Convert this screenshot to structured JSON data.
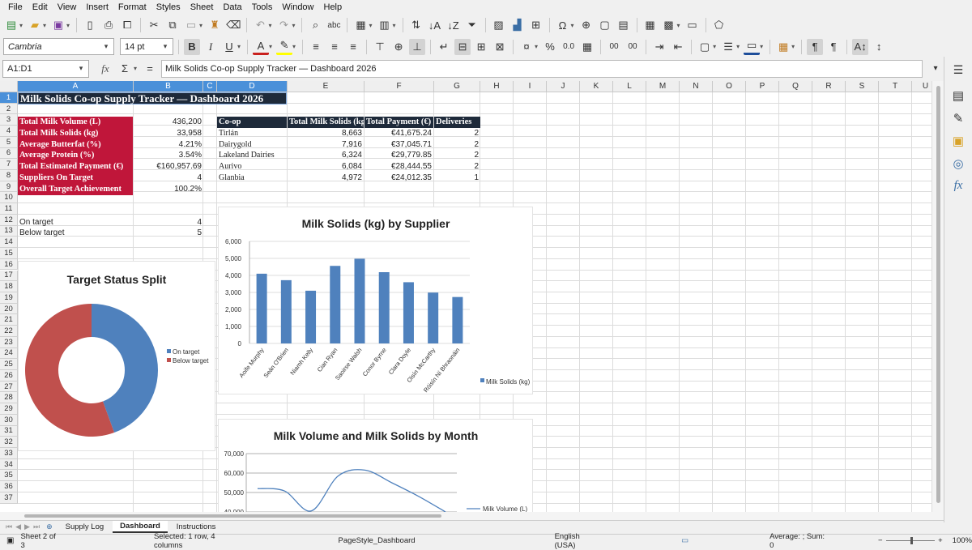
{
  "menu": [
    "File",
    "Edit",
    "View",
    "Insert",
    "Format",
    "Styles",
    "Sheet",
    "Data",
    "Tools",
    "Window",
    "Help"
  ],
  "toolbar": {
    "font_name": "Cambria",
    "font_size": "14 pt",
    "bold": "B",
    "italic": "I",
    "underline": "U",
    "percent": "%",
    "decimal": "0.0",
    "decimal_places": "00",
    "omega": "Ω"
  },
  "formula": {
    "cell_ref": "A1:D1",
    "fx": "fx",
    "sigma": "Σ",
    "equals": "=",
    "content": "Milk Solids Co-op Supply Tracker — Dashboard 2026"
  },
  "columns": [
    "A",
    "B",
    "C",
    "D",
    "E",
    "F",
    "G",
    "H",
    "I",
    "J",
    "K",
    "L",
    "M",
    "N",
    "O",
    "P",
    "Q",
    "R",
    "S",
    "T",
    "U"
  ],
  "rows": [
    "1",
    "2",
    "3",
    "4",
    "5",
    "6",
    "7",
    "8",
    "9",
    "10",
    "11",
    "12",
    "13",
    "14",
    "15",
    "16",
    "17",
    "18",
    "19",
    "20",
    "21",
    "22",
    "23",
    "24",
    "25",
    "26",
    "27",
    "28",
    "29",
    "30",
    "31",
    "32",
    "33",
    "34",
    "35",
    "36",
    "37"
  ],
  "sheet": {
    "title": "Milk Solids Co-op Supply Tracker — Dashboard 2026",
    "kpis": [
      {
        "label": "Total Milk Volume (L)",
        "value": "436,200"
      },
      {
        "label": "Total Milk Solids (kg)",
        "value": "33,958"
      },
      {
        "label": "Average Butterfat (%)",
        "value": "4.21%"
      },
      {
        "label": "Average Protein (%)",
        "value": "3.54%"
      },
      {
        "label": "Total Estimated Payment (€)",
        "value": "€160,957.69"
      },
      {
        "label": "Suppliers On Target",
        "value": "4"
      },
      {
        "label": "Overall Target Achievement",
        "value": "100.2%"
      }
    ],
    "status_rows": [
      {
        "label": "On target",
        "value": "4"
      },
      {
        "label": "Below target",
        "value": "5"
      }
    ],
    "coop_headers": [
      "Co-op",
      "Total Milk Solids (kg",
      "Total Payment (€)",
      "Deliveries"
    ],
    "coops": [
      {
        "name": "Tirlán",
        "solids": "8,663",
        "payment": "€41,675.24",
        "deliveries": "2"
      },
      {
        "name": "Dairygold",
        "solids": "7,916",
        "payment": "€37,045.71",
        "deliveries": "2"
      },
      {
        "name": "Lakeland Dairies",
        "solids": "6,324",
        "payment": "€29,779.85",
        "deliveries": "2"
      },
      {
        "name": "Aurivo",
        "solids": "6,084",
        "payment": "€28,444.55",
        "deliveries": "2"
      },
      {
        "name": "Glanbia",
        "solids": "4,972",
        "payment": "€24,012.35",
        "deliveries": "1"
      }
    ]
  },
  "chart_data": [
    {
      "type": "bar",
      "title": "Milk Solids (kg) by Supplier",
      "categories": [
        "Aoife Murphy",
        "Seán O'Brien",
        "Niamh Kelly",
        "Cian Ryan",
        "Saoirse Walsh",
        "Conor Byrne",
        "Clara Doyle",
        "Oisín McCarthy",
        "Róisín Ní Bhraonáin"
      ],
      "series": [
        {
          "name": "Milk Solids (kg)",
          "values": [
            4100,
            3720,
            3100,
            4560,
            4980,
            4190,
            3600,
            2990,
            2730
          ]
        }
      ],
      "ylim": [
        0,
        6000
      ],
      "yticks": [
        "0",
        "1,000",
        "2,000",
        "3,000",
        "4,000",
        "5,000",
        "6,000"
      ],
      "grid": true,
      "legend": "right",
      "color": "#4f81bd"
    },
    {
      "type": "pie",
      "title": "Target Status Split",
      "labels": [
        "On target",
        "Below target"
      ],
      "values": [
        4,
        5
      ],
      "colors": [
        "#4f81bd",
        "#c0504d"
      ],
      "donut": true,
      "legend": "right"
    },
    {
      "type": "line",
      "title": "Milk Volume and Milk Solids by Month",
      "series": [
        {
          "name": "Milk Volume (L)",
          "values": [
            52000,
            50800,
            40500,
            58500,
            61500,
            55000,
            48000,
            40000
          ]
        }
      ],
      "ylim": [
        40000,
        70000
      ],
      "yticks": [
        "40,000",
        "50,000",
        "60,000",
        "70,000"
      ],
      "grid": true,
      "legend": "right",
      "color": "#4f81bd"
    }
  ],
  "tabs": [
    "Supply Log",
    "Dashboard",
    "Instructions"
  ],
  "active_tab": "Dashboard",
  "status": {
    "sheet": "Sheet 2 of 3",
    "selection": "Selected: 1 row, 4 columns",
    "page_style": "PageStyle_Dashboard",
    "language": "English (USA)",
    "summary": "Average: ; Sum: 0",
    "zoom": "100%",
    "minus": "−",
    "plus": "+"
  }
}
